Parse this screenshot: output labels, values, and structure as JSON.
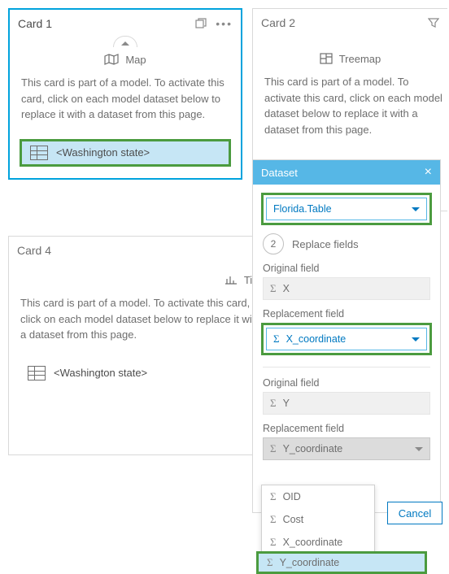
{
  "card1": {
    "title": "Card 1",
    "type_label": "Map",
    "body": "This card is part of a model. To activate this card, click on each model dataset below to replace it with a dataset from this page.",
    "dataset_label": "<Washington state>"
  },
  "card2": {
    "title": "Card 2",
    "type_label": "Treemap",
    "body": "This card is part of a model. To activate this card, click on each model dataset below to replace it with a dataset from this page."
  },
  "card4": {
    "title": "Card 4",
    "type_label": "Tim",
    "body": "This card is part of a model. To activate this card, click on each model dataset below to replace it with a dataset from this page.",
    "dataset_label": "<Washington state>"
  },
  "dataset_panel": {
    "header": "Dataset",
    "select_value": "Florida.Table",
    "step_num": "2",
    "step_label": "Replace fields",
    "orig_label": "Original field",
    "repl_label": "Replacement field",
    "field1_orig": "X",
    "field1_repl": "X_coordinate",
    "field2_orig": "Y",
    "field2_repl": "Y_coordinate",
    "cancel": "Cancel"
  },
  "dropdown": {
    "items": [
      "OID",
      "Cost",
      "X_coordinate",
      "Y_coordinate"
    ]
  }
}
